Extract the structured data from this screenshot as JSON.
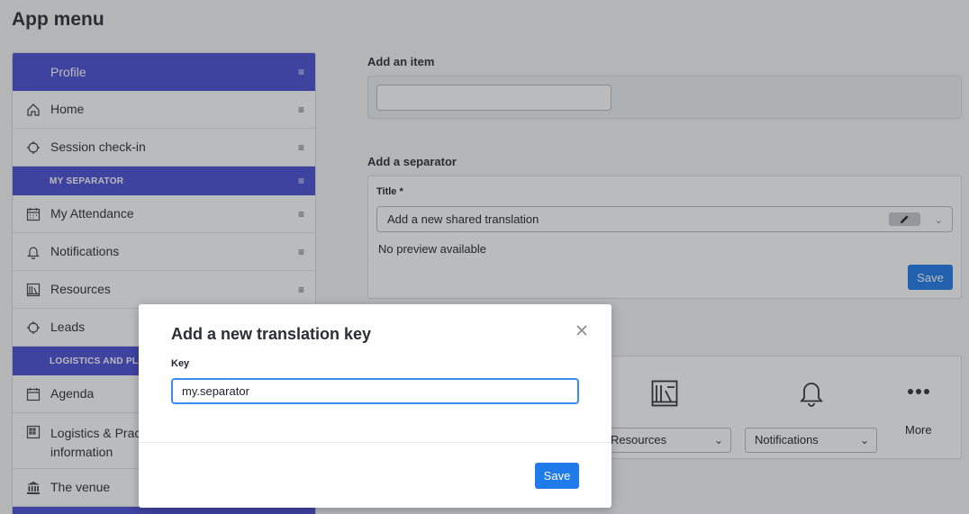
{
  "page": {
    "title": "App menu"
  },
  "menu": {
    "profile_label": "Profile",
    "items": [
      {
        "type": "item",
        "label": "Home",
        "icon": "home-icon"
      },
      {
        "type": "item",
        "label": "Session check-in",
        "icon": "crosshair-icon"
      },
      {
        "type": "separator",
        "label": "MY SEPARATOR"
      },
      {
        "type": "item",
        "label": "My Attendance",
        "icon": "calendar-icon"
      },
      {
        "type": "item",
        "label": "Notifications",
        "icon": "bell-icon"
      },
      {
        "type": "item",
        "label": "Resources",
        "icon": "bookshelf-icon"
      },
      {
        "type": "item",
        "label": "Leads",
        "icon": "crosshair-icon"
      },
      {
        "type": "separator",
        "label": "LOGISTICS AND PLA"
      },
      {
        "type": "item",
        "label": "Agenda",
        "icon": "calendar-icon"
      },
      {
        "type": "item",
        "label": "Logistics & Prac",
        "label2": "information",
        "icon": "building-icon"
      },
      {
        "type": "item",
        "label": "The venue",
        "icon": "bank-icon"
      }
    ]
  },
  "add_item": {
    "label": "Add an item",
    "input_value": ""
  },
  "add_separator": {
    "label": "Add a separator",
    "title_label": "Title *",
    "title_select_value": "Add a new shared translation",
    "preview_text": "No preview available",
    "save_label": "Save"
  },
  "bottom_bar": {
    "resources_select": "Resources",
    "notifications_select": "Notifications",
    "more_label": "More"
  },
  "modal": {
    "title": "Add a new translation key",
    "key_label": "Key",
    "key_value": "my.separator",
    "save_label": "Save"
  },
  "colors": {
    "accent": "#4b4fd6",
    "primary_button": "#1f7bea",
    "focus_border": "#3b8cf0"
  }
}
